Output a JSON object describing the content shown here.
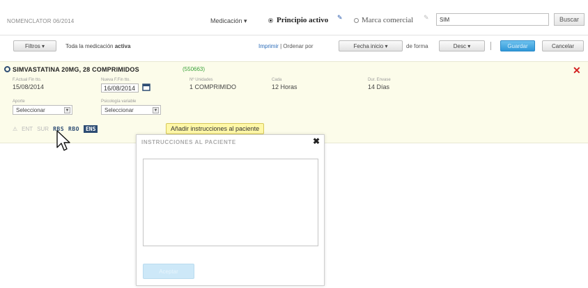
{
  "header": {
    "nomenclator": "NOMENCLATOR 06/2014",
    "medicacion_menu": "Medicación ▾",
    "radio_principio": "Principio activo",
    "radio_marca": "Marca comercial",
    "search_value": "SIM",
    "search_button": "Buscar"
  },
  "toolbar": {
    "filtros": "Filtros ▾",
    "filter_prefix": "Toda la medicación",
    "filter_bold": "activa",
    "imprimir": "Imprimir",
    "ordenar_por": " | Ordenar por",
    "fecha_inicio": "Fecha inicio ▾",
    "de_forma": "de forma",
    "desc": "Desc ▾",
    "guardar": "Guardar",
    "cancelar": "Cancelar"
  },
  "medication": {
    "name": "SIMVASTATINA 20MG, 28 COMPRIMIDOS",
    "code": "(550663)",
    "f_actual_label": "F.Actual Fin tto.",
    "f_actual_value": "15/08/2014",
    "nueva_label": "Nueva F.Fin tto.",
    "nueva_value": "16/08/2014",
    "unidades_label": "Nº Unidades",
    "unidades_value": "1 COMPRIMIDO",
    "cada_label": "Cada",
    "cada_value": "12 Horas",
    "duracion_label": "Dur. Envase",
    "duracion_value": "14 Días",
    "aporte_label": "Aporte",
    "aporte_value": "Seleccionar",
    "psico_label": "Psicología variable",
    "psico_value": "Seleccionar",
    "actions": {
      "a1": "⚠",
      "a2": "ENT",
      "a3": "SUR",
      "a4": "RBS",
      "a5": "RBO",
      "ens": "ENS"
    },
    "tooltip": "Añadir instrucciones al paciente"
  },
  "modal": {
    "title": "INSTRUCCIONES AL PACIENTE",
    "close": "✖",
    "accept": "Aceptar"
  },
  "colors": {
    "accent": "#2f97d8",
    "card_bg": "#fcfcea",
    "close_red": "#d32020",
    "navy": "#2d4c73"
  },
  "icons": [
    "pencil-icon",
    "calendar-icon",
    "close-icon",
    "warning-icon",
    "drug-icon",
    "cursor-icon"
  ]
}
